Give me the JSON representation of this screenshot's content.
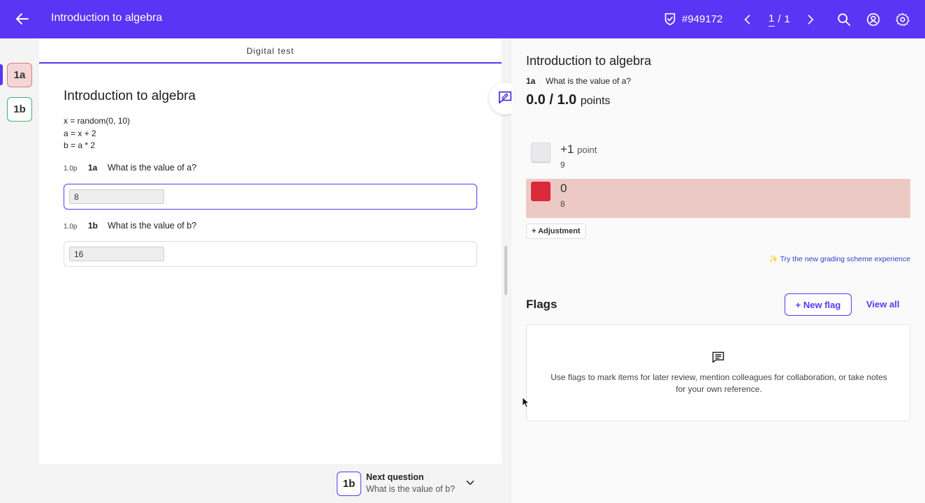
{
  "topbar": {
    "title": "Introduction to algebra",
    "submission_id": "#949172",
    "pager_current": "1",
    "pager_sep": "/",
    "pager_total": "1",
    "color": "#5b35f5"
  },
  "rail": {
    "items": [
      {
        "label": "1a",
        "status": "incorrect"
      },
      {
        "label": "1b",
        "status": "correct"
      }
    ]
  },
  "test": {
    "tab_label": "Digital test",
    "title": "Introduction to algebra",
    "code_lines": [
      "x = random(0, 10)",
      "a = x + 2",
      "b = a * 2"
    ],
    "questions": [
      {
        "points": "1.0p",
        "id": "1a",
        "text": "What is the value of a?",
        "answer": "8"
      },
      {
        "points": "1.0p",
        "id": "1b",
        "text": "What is the value of b?",
        "answer": "16"
      }
    ]
  },
  "next": {
    "badge": "1b",
    "label": "Next question",
    "question": "What is the value of b?"
  },
  "grading": {
    "title": "Introduction to algebra",
    "question_id": "1a",
    "question_text": "What is the value of a?",
    "score": "0.0 / 1.0",
    "score_unit": "points",
    "options": [
      {
        "main": "+1",
        "unit": "point",
        "value": "9"
      },
      {
        "main": "0",
        "unit": "",
        "value": "8"
      }
    ],
    "adjustment_label": "+ Adjustment",
    "try_link": "✨ Try the new grading scheme experience"
  },
  "flags": {
    "title": "Flags",
    "new_flag_label": "+ New flag",
    "view_all_label": "View all",
    "empty_text": "Use flags to mark items for later review, mention colleagues for collaboration, or take notes for your own reference."
  }
}
